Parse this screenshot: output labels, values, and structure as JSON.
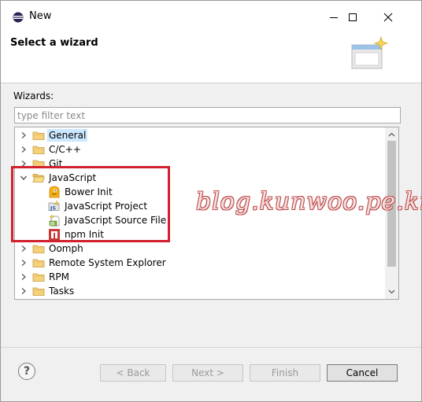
{
  "window": {
    "title": "New",
    "icon": "eclipse-icon",
    "controls": [
      "minimize-icon",
      "maximize-icon",
      "close-icon"
    ]
  },
  "header": {
    "title": "Select a wizard",
    "banner_icon": "wizard-banner-icon"
  },
  "wizards": {
    "label": "Wizards:",
    "filter_placeholder": "type filter text",
    "filter_value": ""
  },
  "tree": {
    "items": [
      {
        "label": "General",
        "level": 0,
        "expanded": false,
        "selected": true,
        "icon": "folder-icon"
      },
      {
        "label": "C/C++",
        "level": 0,
        "expanded": false,
        "selected": false,
        "icon": "folder-icon"
      },
      {
        "label": "Git",
        "level": 0,
        "expanded": false,
        "selected": false,
        "icon": "folder-icon"
      },
      {
        "label": "JavaScript",
        "level": 0,
        "expanded": true,
        "selected": false,
        "icon": "folder-open-icon"
      },
      {
        "label": "Bower Init",
        "level": 1,
        "selected": false,
        "icon": "bower-icon"
      },
      {
        "label": "JavaScript Project",
        "level": 1,
        "selected": false,
        "icon": "js-project-icon"
      },
      {
        "label": "JavaScript Source File",
        "level": 1,
        "selected": false,
        "icon": "js-source-file-icon"
      },
      {
        "label": "npm Init",
        "level": 1,
        "selected": false,
        "icon": "npm-icon"
      },
      {
        "label": "Oomph",
        "level": 0,
        "expanded": false,
        "selected": false,
        "icon": "folder-icon"
      },
      {
        "label": "Remote System Explorer",
        "level": 0,
        "expanded": false,
        "selected": false,
        "icon": "folder-icon"
      },
      {
        "label": "RPM",
        "level": 0,
        "expanded": false,
        "selected": false,
        "icon": "folder-icon"
      },
      {
        "label": "Tasks",
        "level": 0,
        "expanded": false,
        "selected": false,
        "icon": "folder-icon"
      }
    ]
  },
  "watermark": "blog.kunwoo.pe.kr",
  "footer": {
    "help_symbol": "?",
    "back_label": "< Back",
    "next_label": "Next >",
    "finish_label": "Finish",
    "cancel_label": "Cancel"
  },
  "colors": {
    "selection": "#cce8ff",
    "highlight_border": "#d1202f",
    "folder": "#e8b75a"
  }
}
